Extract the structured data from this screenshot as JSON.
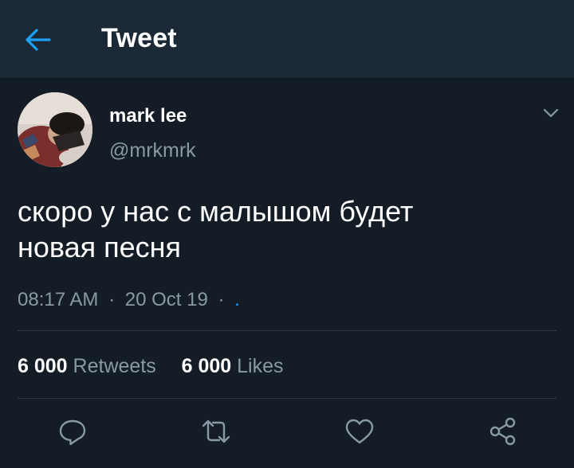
{
  "header": {
    "title": "Tweet",
    "back_icon": "arrow-left-icon"
  },
  "user": {
    "name": "mark lee",
    "handle": "@mrkmrk"
  },
  "tweet": {
    "text_line1": "скоро у нас с малышом будет",
    "text_line2": "новая песня",
    "time": "08:17 AM",
    "sep1": "·",
    "date": "20 Oct 19",
    "sep2": "·",
    "source": "."
  },
  "stats": {
    "retweets_count": "6 000",
    "retweets_label": "Retweets",
    "likes_count": "6 000",
    "likes_label": "Likes"
  },
  "actions": [
    "reply-icon",
    "retweet-icon",
    "like-icon",
    "share-icon"
  ],
  "colors": {
    "background": "#141d26",
    "header": "#1b2836",
    "accent": "#1da1f2",
    "muted": "#8899a6"
  }
}
